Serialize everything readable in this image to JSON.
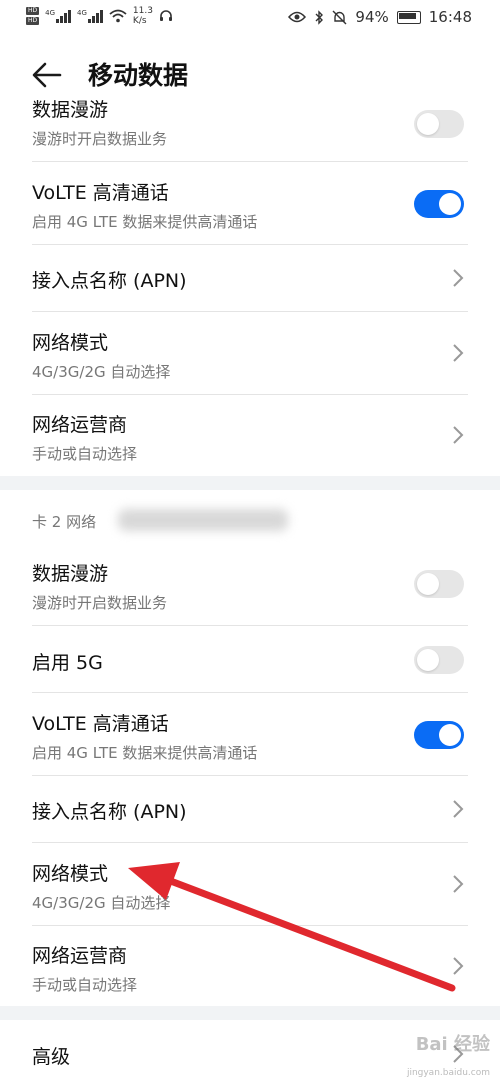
{
  "status_bar": {
    "sim1": "HD",
    "sim2": "HD",
    "net1": "4G",
    "net2": "4G",
    "speed_value": "11.3",
    "speed_unit": "K/s",
    "battery": "94%",
    "time": "16:48"
  },
  "header": {
    "title": "移动数据"
  },
  "card1": {
    "roaming": {
      "title": "数据漫游",
      "subtitle": "漫游时开启数据业务",
      "enabled": false
    },
    "volte": {
      "title": "VoLTE 高清通话",
      "subtitle": "启用 4G LTE 数据来提供高清通话",
      "enabled": true
    },
    "apn": {
      "title": "接入点名称 (APN)"
    },
    "network_mode": {
      "title": "网络模式",
      "subtitle": "4G/3G/2G 自动选择"
    },
    "operator": {
      "title": "网络运营商",
      "subtitle": "手动或自动选择"
    }
  },
  "card2": {
    "section_label": "卡 2 网络",
    "roaming": {
      "title": "数据漫游",
      "subtitle": "漫游时开启数据业务",
      "enabled": false
    },
    "enable_5g": {
      "title": "启用 5G",
      "enabled": false
    },
    "volte": {
      "title": "VoLTE 高清通话",
      "subtitle": "启用 4G LTE 数据来提供高清通话",
      "enabled": true
    },
    "apn": {
      "title": "接入点名称 (APN)"
    },
    "network_mode": {
      "title": "网络模式",
      "subtitle": "4G/3G/2G 自动选择"
    },
    "operator": {
      "title": "网络运营商",
      "subtitle": "手动或自动选择"
    }
  },
  "advanced": {
    "title": "高级"
  },
  "watermark": {
    "main": "Bai 经验",
    "sub": "jingyan.baidu.com"
  },
  "colors": {
    "accent": "#0a6cf5",
    "annotation_arrow": "#e0282e"
  }
}
